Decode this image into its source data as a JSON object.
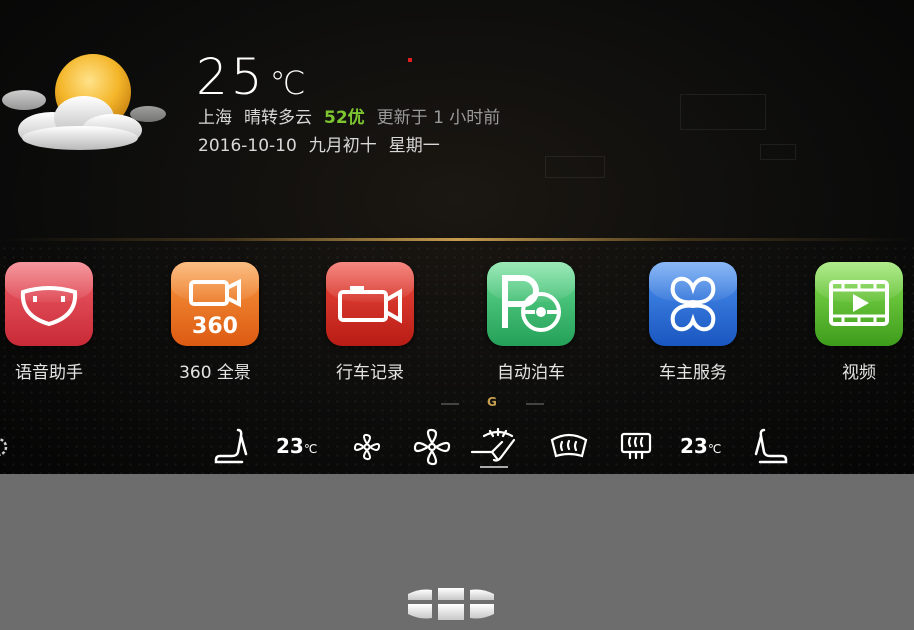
{
  "weather": {
    "temperature": "25",
    "unit": "℃",
    "city": "上海",
    "condition": "晴转多云",
    "aqi": "52优",
    "updated": "更新于 1 小时前",
    "date": "2016-10-10",
    "lunar_date": "九月初十",
    "weekday": "星期一"
  },
  "apps": [
    {
      "label": "语音助手",
      "icon": "voice-assistant-icon",
      "color": "#e0404a"
    },
    {
      "label": "360 全景",
      "icon": "camera-360-icon",
      "color": "#f07020"
    },
    {
      "label": "行车记录",
      "icon": "dashcam-icon",
      "color": "#d02a20"
    },
    {
      "label": "自动泊车",
      "icon": "auto-parking-icon",
      "color": "#3cba70"
    },
    {
      "label": "车主服务",
      "icon": "owner-service-icon",
      "color": "#2a70d8"
    },
    {
      "label": "视频",
      "icon": "video-icon",
      "color": "#5ab830"
    }
  ],
  "page_indicator": "G",
  "climate": {
    "left_temp": "23",
    "right_temp": "23",
    "temp_unit": "℃"
  },
  "colors": {
    "accent": "#c8a050",
    "aqi_good": "#7ec630"
  }
}
